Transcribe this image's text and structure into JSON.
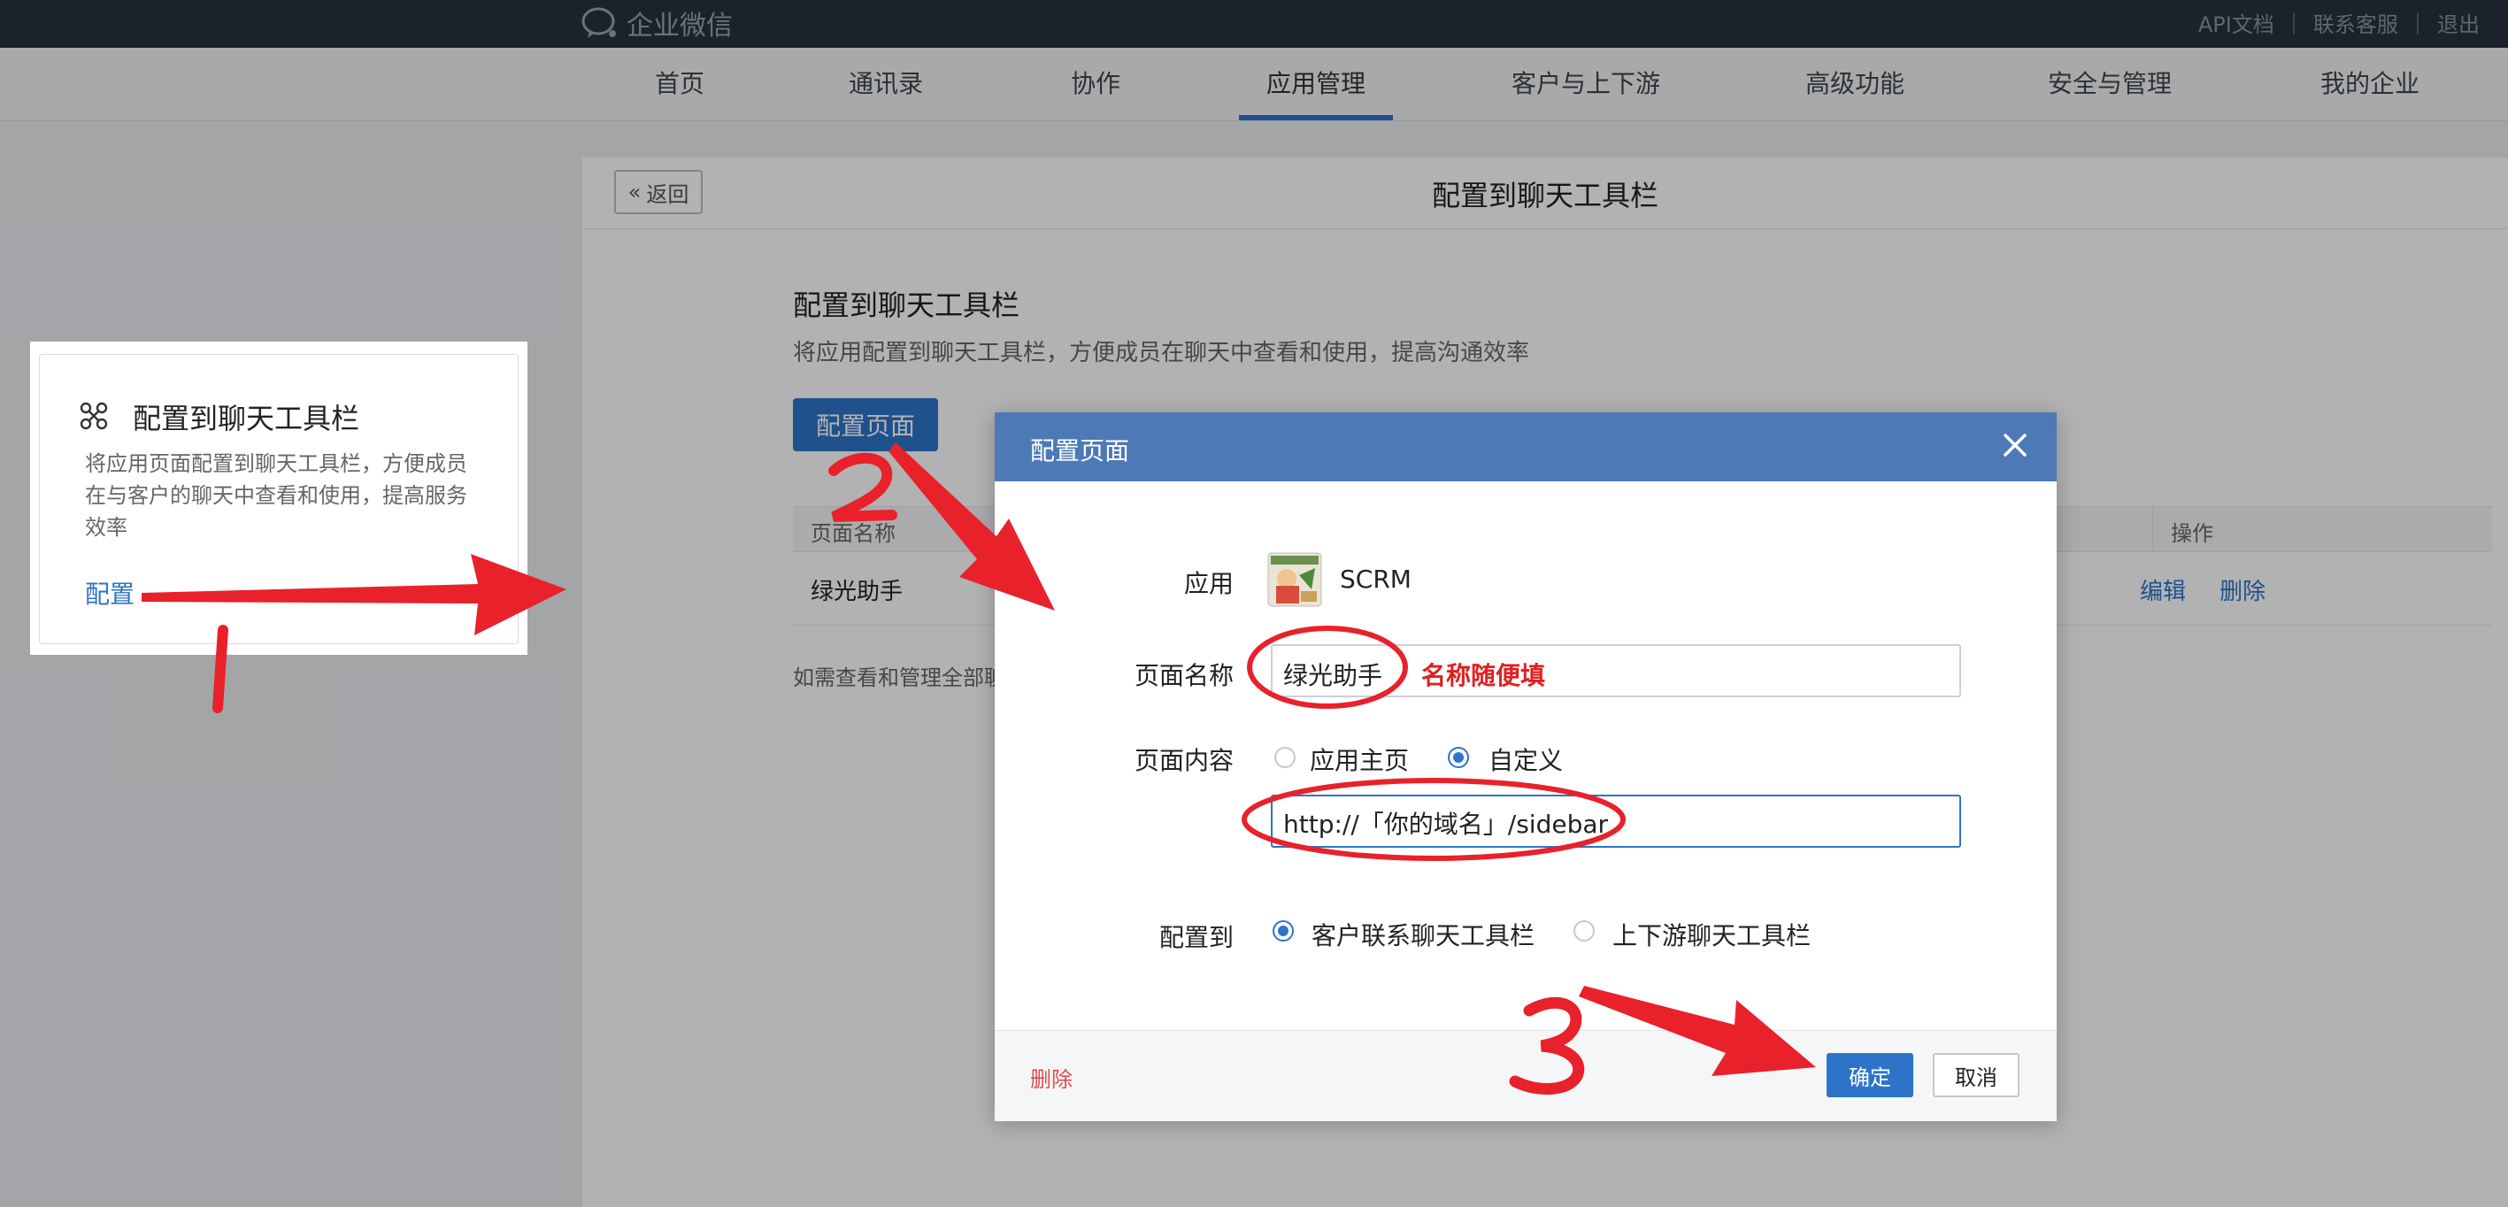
{
  "topbar": {
    "brand": "企业微信",
    "links": [
      "API文档",
      "联系客服",
      "退出"
    ]
  },
  "nav": {
    "items": [
      "首页",
      "通讯录",
      "协作",
      "应用管理",
      "客户与上下游",
      "高级功能",
      "安全与管理",
      "我的企业"
    ],
    "active": "应用管理"
  },
  "panel": {
    "back": "返回",
    "title": "配置到聊天工具栏",
    "section_title": "配置到聊天工具栏",
    "section_desc": "将应用配置到聊天工具栏，方便成员在聊天中查看和使用，提高沟通效率",
    "config_button": "配置页面",
    "table": {
      "col_name": "页面名称",
      "col_op": "操作",
      "rows": [
        {
          "name": "绿光助手",
          "edit": "编辑",
          "delete": "删除"
        }
      ]
    },
    "footnote": "如需查看和管理全部聊"
  },
  "callout": {
    "title": "配置到聊天工具栏",
    "desc": "将应用页面配置到聊天工具栏，方便成员在与客户的聊天中查看和使用，提高服务效率",
    "link": "配置"
  },
  "dialog": {
    "title": "配置页面",
    "app_label": "应用",
    "app_name": "SCRM",
    "page_name_label": "页面名称",
    "page_name_value": "绿光助手",
    "page_name_note": "名称随便填",
    "content_label": "页面内容",
    "content_options": [
      "应用主页",
      "自定义"
    ],
    "content_selected": "自定义",
    "url_value": "http://「你的域名」/sidebar",
    "target_label": "配置到",
    "target_options": [
      "客户联系聊天工具栏",
      "上下游聊天工具栏"
    ],
    "target_selected": "客户联系聊天工具栏",
    "delete": "删除",
    "ok": "确定",
    "cancel": "取消"
  },
  "annotations": {
    "step1": "1",
    "step2": "2",
    "step3": "3",
    "color": "#e8212a"
  }
}
